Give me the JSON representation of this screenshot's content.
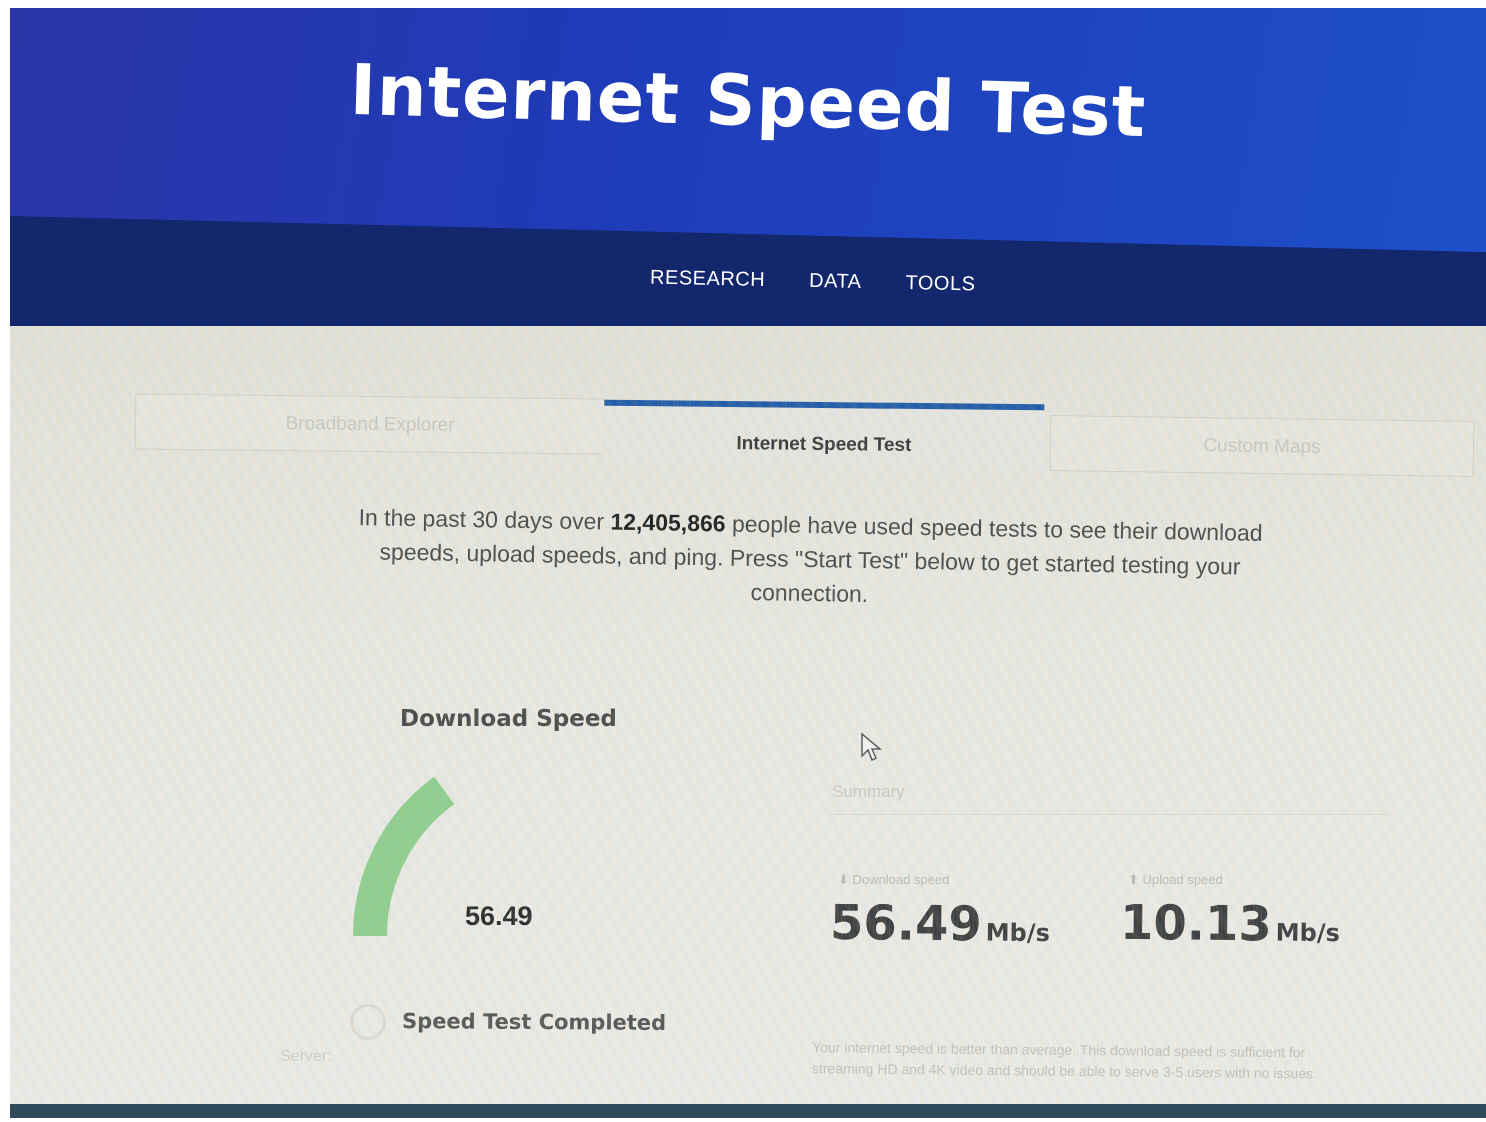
{
  "header": {
    "title": "Internet Speed Test"
  },
  "nav": {
    "items": [
      "RESEARCH",
      "DATA",
      "TOOLS"
    ]
  },
  "tabs": {
    "left": "Broadband Explorer",
    "active": "Internet Speed Test",
    "right": "Custom Maps"
  },
  "intro": {
    "prefix": "In the past 30 days over ",
    "count": "12,405,866",
    "suffix": " people have used speed tests to see their download speeds, upload speeds, and ping. Press \"Start Test\" below to get started testing your connection."
  },
  "gauge": {
    "title": "Download Speed",
    "value": "56.49",
    "fill_fraction": 0.3,
    "color": "#8fce8f"
  },
  "summary": {
    "label": "Summary",
    "download_label": "Download speed",
    "download_value": "56.49",
    "download_unit": "Mb/s",
    "upload_label": "Upload speed",
    "upload_value": "10.13",
    "upload_unit": "Mb/s",
    "verdict": "Your internet speed is better than average. This download speed is sufficient for streaming HD and 4K video and should be able to serve 3-5 users with no issues."
  },
  "status": {
    "text": "Speed Test Completed",
    "server": "Server:"
  },
  "colors": {
    "header_blue": "#1f3bb8",
    "nav_navy": "#13276c",
    "active_tab_bar": "#1f5aa8"
  }
}
